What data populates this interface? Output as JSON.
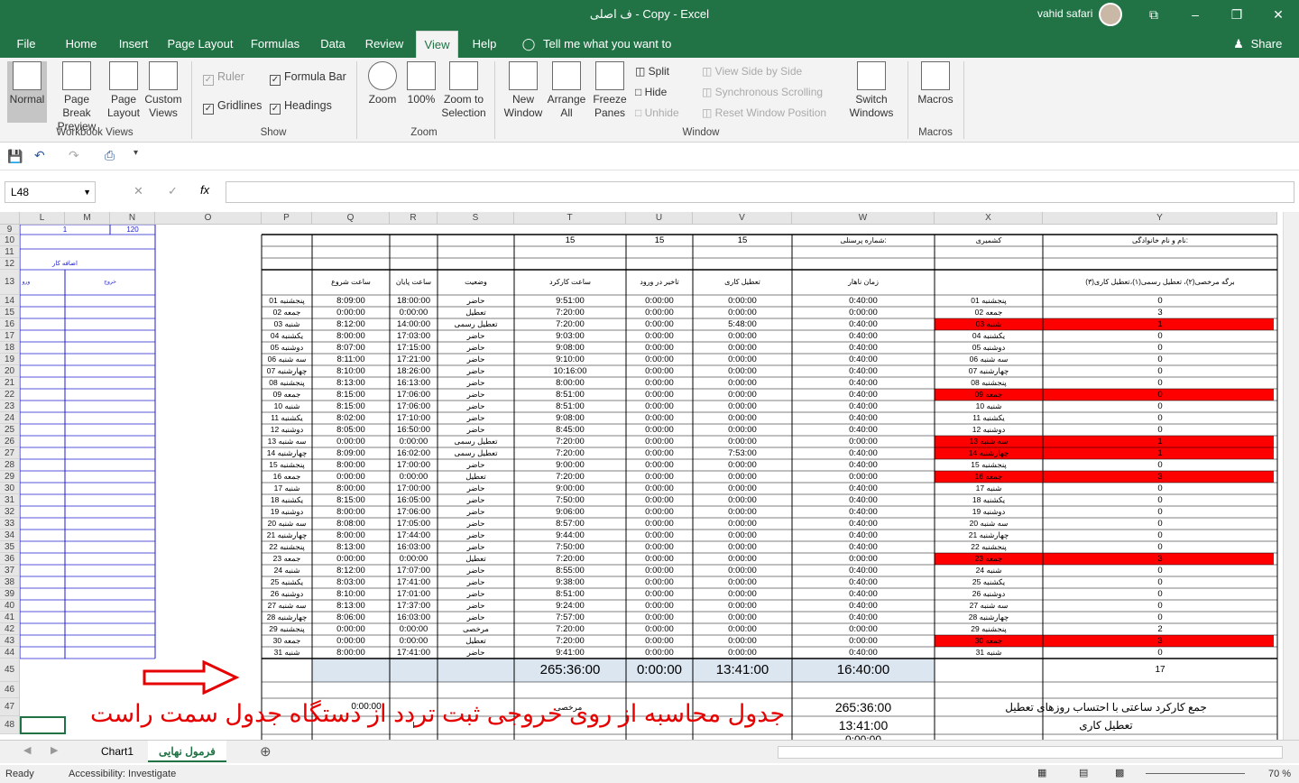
{
  "window": {
    "title": "ف اصلی - Copy  -  Excel",
    "user": "vahid safari",
    "min": "–",
    "max": "❐",
    "close": "✕",
    "ribbon_display": "⧉"
  },
  "tabs": [
    "File",
    "Home",
    "Insert",
    "Page Layout",
    "Formulas",
    "Data",
    "Review",
    "View",
    "Help"
  ],
  "tell_me": "Tell me what you want to do",
  "share": "Share",
  "ribbon": {
    "normal": "Normal",
    "page_break": "Page Break Preview",
    "page_layout": "Page Layout",
    "custom_views": "Custom Views",
    "group_workbook": "Workbook Views",
    "ruler": "Ruler",
    "formula_bar": "Formula Bar",
    "gridlines": "Gridlines",
    "headings": "Headings",
    "group_show": "Show",
    "zoom": "Zoom",
    "zoom100": "100%",
    "zoom_sel": "Zoom to Selection",
    "group_zoom": "Zoom",
    "new_window": "New Window",
    "arrange_all": "Arrange All",
    "freeze": "Freeze Panes",
    "split": "Split",
    "hide": "Hide",
    "unhide": "Unhide",
    "side_by_side": "View Side by Side",
    "sync_scroll": "Synchronous Scrolling",
    "reset_pos": "Reset Window Position",
    "switch": "Switch Windows",
    "group_window": "Window",
    "macros": "Macros",
    "group_macros": "Macros"
  },
  "namebox": "L48",
  "fx": "fx",
  "columns": [
    "L",
    "M",
    "N",
    "O",
    "P",
    "Q",
    "R",
    "S",
    "T",
    "U",
    "V",
    "W",
    "X",
    "Y"
  ],
  "rows": [
    "9",
    "10",
    "11",
    "12",
    "13",
    "14",
    "15",
    "16",
    "17",
    "18",
    "19",
    "20",
    "21",
    "22",
    "23",
    "24",
    "25",
    "26",
    "27",
    "28",
    "29",
    "30",
    "31",
    "32",
    "33",
    "34",
    "35",
    "36",
    "37",
    "38",
    "39",
    "40",
    "41",
    "42",
    "43",
    "44",
    "45",
    "46",
    "47",
    "48"
  ],
  "left": {
    "r9_l": "1",
    "r9_n": "120",
    "r12": "اضافه کار",
    "r13_l": "ورو",
    "r13_m": "خروج"
  },
  "header_row10": {
    "t": "15",
    "u": "15",
    "v": "15",
    "w": "شماره پرسنلی:",
    "x": "کشمیری",
    "y": "نام و نام خانوادگی:"
  },
  "table_headers": {
    "q": "ساعت شروع",
    "r": "ساعت پایان",
    "s": "وضعیت",
    "t": "ساعت  کارکرد",
    "u": "تاخیر در ورود",
    "v": "تعطیل کاری",
    "w": "زمان ناهار",
    "y": "برگه مرخصی(۲)، تعطیل رسمی(۱)،تعطیل کاری(۳)"
  },
  "days": [
    [
      "پنجشنبه 01",
      "8:09:00",
      "18:00:00",
      "حاضر",
      "9:51:00",
      "0:00:00",
      "0:00:00",
      "0:40:00",
      "پنجشنبه 01",
      "0",
      ""
    ],
    [
      "جمعه 02",
      "0:00:00",
      "0:00:00",
      "تعطیل",
      "7:20:00",
      "0:00:00",
      "0:00:00",
      "0:00:00",
      "جمعه 02",
      "3",
      ""
    ],
    [
      "شنبه 03",
      "8:12:00",
      "14:00:00",
      "تعطیل رسمی",
      "7:20:00",
      "0:00:00",
      "5:48:00",
      "0:40:00",
      "شنبه 03",
      "1",
      "r"
    ],
    [
      "یکشنبه 04",
      "8:00:00",
      "17:03:00",
      "حاضر",
      "9:03:00",
      "0:00:00",
      "0:00:00",
      "0:40:00",
      "یکشنبه 04",
      "0",
      ""
    ],
    [
      "دوشنبه 05",
      "8:07:00",
      "17:15:00",
      "حاضر",
      "9:08:00",
      "0:00:00",
      "0:00:00",
      "0:40:00",
      "دوشنبه 05",
      "0",
      ""
    ],
    [
      "سه شنبه 06",
      "8:11:00",
      "17:21:00",
      "حاضر",
      "9:10:00",
      "0:00:00",
      "0:00:00",
      "0:40:00",
      "سه شنبه 06",
      "0",
      ""
    ],
    [
      "چهارشنبه 07",
      "8:10:00",
      "18:26:00",
      "حاضر",
      "10:16:00",
      "0:00:00",
      "0:00:00",
      "0:40:00",
      "چهارشنبه 07",
      "0",
      ""
    ],
    [
      "پنجشنبه 08",
      "8:13:00",
      "16:13:00",
      "حاضر",
      "8:00:00",
      "0:00:00",
      "0:00:00",
      "0:40:00",
      "پنجشنبه 08",
      "0",
      ""
    ],
    [
      "جمعه 09",
      "8:15:00",
      "17:06:00",
      "حاضر",
      "8:51:00",
      "0:00:00",
      "0:00:00",
      "0:40:00",
      "جمعه 09",
      "0",
      "r"
    ],
    [
      "شنبه 10",
      "8:15:00",
      "17:06:00",
      "حاضر",
      "8:51:00",
      "0:00:00",
      "0:00:00",
      "0:40:00",
      "شنبه 10",
      "0",
      ""
    ],
    [
      "یکشنبه 11",
      "8:02:00",
      "17:10:00",
      "حاضر",
      "9:08:00",
      "0:00:00",
      "0:00:00",
      "0:40:00",
      "یکشنبه 11",
      "0",
      ""
    ],
    [
      "دوشنبه 12",
      "8:05:00",
      "16:50:00",
      "حاضر",
      "8:45:00",
      "0:00:00",
      "0:00:00",
      "0:40:00",
      "دوشنبه 12",
      "0",
      ""
    ],
    [
      "سه شنبه 13",
      "0:00:00",
      "0:00:00",
      "تعطیل رسمی",
      "7:20:00",
      "0:00:00",
      "0:00:00",
      "0:00:00",
      "سه شنبه 13",
      "1",
      "r"
    ],
    [
      "چهارشنبه 14",
      "8:09:00",
      "16:02:00",
      "تعطیل رسمی",
      "7:20:00",
      "0:00:00",
      "7:53:00",
      "0:40:00",
      "چهارشنبه 14",
      "1",
      "r"
    ],
    [
      "پنجشنبه 15",
      "8:00:00",
      "17:00:00",
      "حاضر",
      "9:00:00",
      "0:00:00",
      "0:00:00",
      "0:40:00",
      "پنجشنبه 15",
      "0",
      ""
    ],
    [
      "جمعه 16",
      "0:00:00",
      "0:00:00",
      "تعطیل",
      "7:20:00",
      "0:00:00",
      "0:00:00",
      "0:00:00",
      "جمعه 16",
      "3",
      "r"
    ],
    [
      "شنبه 17",
      "8:00:00",
      "17:00:00",
      "حاضر",
      "9:00:00",
      "0:00:00",
      "0:00:00",
      "0:40:00",
      "شنبه 17",
      "0",
      ""
    ],
    [
      "یکشنبه 18",
      "8:15:00",
      "16:05:00",
      "حاضر",
      "7:50:00",
      "0:00:00",
      "0:00:00",
      "0:40:00",
      "یکشنبه 18",
      "0",
      ""
    ],
    [
      "دوشنبه 19",
      "8:00:00",
      "17:06:00",
      "حاضر",
      "9:06:00",
      "0:00:00",
      "0:00:00",
      "0:40:00",
      "دوشنبه 19",
      "0",
      ""
    ],
    [
      "سه شنبه 20",
      "8:08:00",
      "17:05:00",
      "حاضر",
      "8:57:00",
      "0:00:00",
      "0:00:00",
      "0:40:00",
      "سه شنبه 20",
      "0",
      ""
    ],
    [
      "چهارشنبه 21",
      "8:00:00",
      "17:44:00",
      "حاضر",
      "9:44:00",
      "0:00:00",
      "0:00:00",
      "0:40:00",
      "چهارشنبه 21",
      "0",
      ""
    ],
    [
      "پنجشنبه 22",
      "8:13:00",
      "16:03:00",
      "حاضر",
      "7:50:00",
      "0:00:00",
      "0:00:00",
      "0:40:00",
      "پنجشنبه 22",
      "0",
      ""
    ],
    [
      "جمعه 23",
      "0:00:00",
      "0:00:00",
      "تعطیل",
      "7:20:00",
      "0:00:00",
      "0:00:00",
      "0:00:00",
      "جمعه 23",
      "3",
      "r"
    ],
    [
      "شنبه 24",
      "8:12:00",
      "17:07:00",
      "حاضر",
      "8:55:00",
      "0:00:00",
      "0:00:00",
      "0:40:00",
      "شنبه 24",
      "0",
      ""
    ],
    [
      "یکشنبه 25",
      "8:03:00",
      "17:41:00",
      "حاضر",
      "9:38:00",
      "0:00:00",
      "0:00:00",
      "0:40:00",
      "یکشنبه 25",
      "0",
      ""
    ],
    [
      "دوشنبه 26",
      "8:10:00",
      "17:01:00",
      "حاضر",
      "8:51:00",
      "0:00:00",
      "0:00:00",
      "0:40:00",
      "دوشنبه 26",
      "0",
      ""
    ],
    [
      "سه شنبه 27",
      "8:13:00",
      "17:37:00",
      "حاضر",
      "9:24:00",
      "0:00:00",
      "0:00:00",
      "0:40:00",
      "سه شنبه 27",
      "0",
      ""
    ],
    [
      "چهارشنبه 28",
      "8:06:00",
      "16:03:00",
      "حاضر",
      "7:57:00",
      "0:00:00",
      "0:00:00",
      "0:40:00",
      "چهارشنبه 28",
      "0",
      ""
    ],
    [
      "پنجشنبه 29",
      "0:00:00",
      "0:00:00",
      "مرخصی",
      "7:20:00",
      "0:00:00",
      "0:00:00",
      "0:00:00",
      "پنجشنبه 29",
      "2",
      ""
    ],
    [
      "جمعه 30",
      "0:00:00",
      "0:00:00",
      "تعطیل",
      "7:20:00",
      "0:00:00",
      "0:00:00",
      "0:00:00",
      "جمعه 30",
      "3",
      "r"
    ],
    [
      "شنبه 31",
      "8:00:00",
      "17:41:00",
      "حاضر",
      "9:41:00",
      "0:00:00",
      "0:00:00",
      "0:40:00",
      "شنبه 31",
      "0",
      ""
    ]
  ],
  "totals": {
    "t": "265:36:00",
    "u": "0:00:00",
    "v": "13:41:00",
    "w": "16:40:00",
    "y": "17"
  },
  "summary": {
    "r47_q": "0:00:00",
    "r47_s": "مرخصی",
    "r47_w": "265:36:00",
    "r47_y": "جمع کارکرد ساعتی با احتساب روزهای تعطیل",
    "r48_w": "13:41:00",
    "r48_y": "تعطیل کاری",
    "r48_r": "ا",
    "r49_w": "0:00:00"
  },
  "annotation": "جدول محاسبه از روی خروجی ثبت تردد از دستگاه جدول سمت راست",
  "sheets": [
    "Chart1",
    "فرمول نهایی"
  ],
  "status": {
    "ready": "Ready",
    "accessibility": "Accessibility: Investigate",
    "zoom": "70 %"
  },
  "colors": {
    "excel_green": "#217346",
    "holiday_red": "#ff0000",
    "table_blue": "#1c1ccf",
    "total_fill": "#dbe6f1"
  }
}
